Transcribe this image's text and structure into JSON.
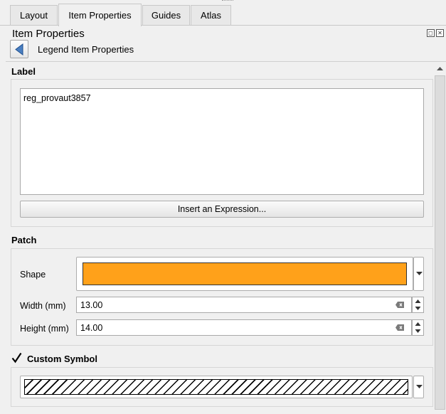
{
  "tabs": [
    {
      "label": "Layout",
      "active": false
    },
    {
      "label": "Item Properties",
      "active": true
    },
    {
      "label": "Guides",
      "active": false
    },
    {
      "label": "Atlas",
      "active": false
    }
  ],
  "panel": {
    "title": "Item Properties",
    "subtitle": "Legend Item Properties",
    "back_icon": "left-triangle-icon"
  },
  "label_section": {
    "header": "Label",
    "text": "reg_provaut3857",
    "insert_button": "Insert an Expression..."
  },
  "patch_section": {
    "header": "Patch",
    "shape_label": "Shape",
    "shape_color": "#ffa11a",
    "width_label": "Width (mm)",
    "width_value": "13.00",
    "height_label": "Height (mm)",
    "height_value": "14.00"
  },
  "custom_symbol": {
    "label": "Custom Symbol",
    "checked": true,
    "pattern": "diagonal-hatch"
  },
  "colors": {
    "panel_bg": "#f0f0f0",
    "border": "#adadad"
  }
}
